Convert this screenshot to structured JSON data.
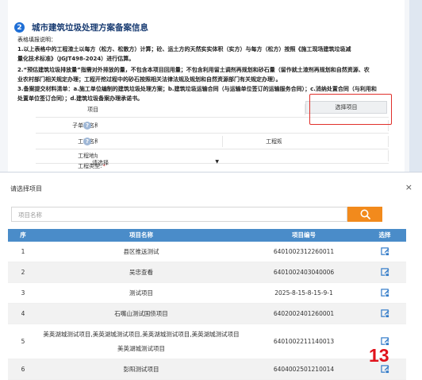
{
  "section": {
    "number": "2",
    "title": "城市建筑垃圾处理方案备案信息"
  },
  "guide": {
    "heading": "表格填报说明：",
    "line1": "1.以上表格中的工程渣土以每方（松方、松散方）计算；砼、运土方的天然实实体积（实方）与每方（松方）按照《施工现场建筑垃圾减",
    "line1b": "量化技术标准》（JGJT498-2024）进行估算。",
    "line2": "2.“预估建筑垃圾排放量”指需对外排放的量，不包含本项目回用量；不包含利用留土调剂再规划和砂石量（留作就土渣剂再规划和自然资源、农",
    "line2b": "业农村部门相关规定办理；工程开挖过程中的砂石按照相关法律法规及规划和自然资源部门有关规定办理）。",
    "line3": "3.备案提交材料清单：a.施工单位编制的建筑垃圾处理方案；b.建筑垃圾运输合同（与运输单位签订的运输服务合同）；c.消纳处置合同（与利用和",
    "line3b": "处置单位签订合同）；d.建筑垃圾备案办理承诺书。"
  },
  "form": {
    "project_name_label": "项目名称:",
    "subproject_label": "子单项名称:",
    "engineering_name_label": "工程名称:",
    "engineering_address_label": "工程地址:",
    "engineering_type_label": "工程类型:",
    "engineering_scale_label": "工程规模（平方米）:",
    "required_mark": "*",
    "help_mark": "?",
    "choose_project_button": "选择项目",
    "engineering_type_value": "请选择",
    "dropdown_arrow": "▼"
  },
  "modal": {
    "title": "请选择项目",
    "close": "×",
    "search_placeholder": "项目名称",
    "columns": [
      "序",
      "项目名称",
      "项目编号",
      "选择"
    ],
    "rows": [
      {
        "no": "1",
        "name": "县区推送测试",
        "code": "6401002312260011"
      },
      {
        "no": "2",
        "name": "吴忠查看",
        "code": "6401002403040006"
      },
      {
        "no": "3",
        "name": "测试项目",
        "code": "2025-8-15-8-15-9-1"
      },
      {
        "no": "4",
        "name": "石嘴山测试国债项目",
        "code": "6402002401260001"
      },
      {
        "no": "5",
        "name_line1": "美英湖城测试项目,美英湖城测试项目,美英湖城测试项目,美英湖城测试项目",
        "name_line2": "美英湖城测试项目",
        "code": "6401002211140013"
      },
      {
        "no": "6",
        "name": "彭阳测试项目",
        "code": "6404002501210014"
      }
    ]
  },
  "annotation": {
    "number": "13"
  },
  "colors": {
    "accent_blue": "#4a8cc9",
    "search_orange": "#f28a1c",
    "annotation_red": "#e0121b",
    "section_blue": "#1f6fd6"
  },
  "icons": {
    "search": "search-icon",
    "select": "select-edit-icon",
    "close": "close-icon"
  }
}
